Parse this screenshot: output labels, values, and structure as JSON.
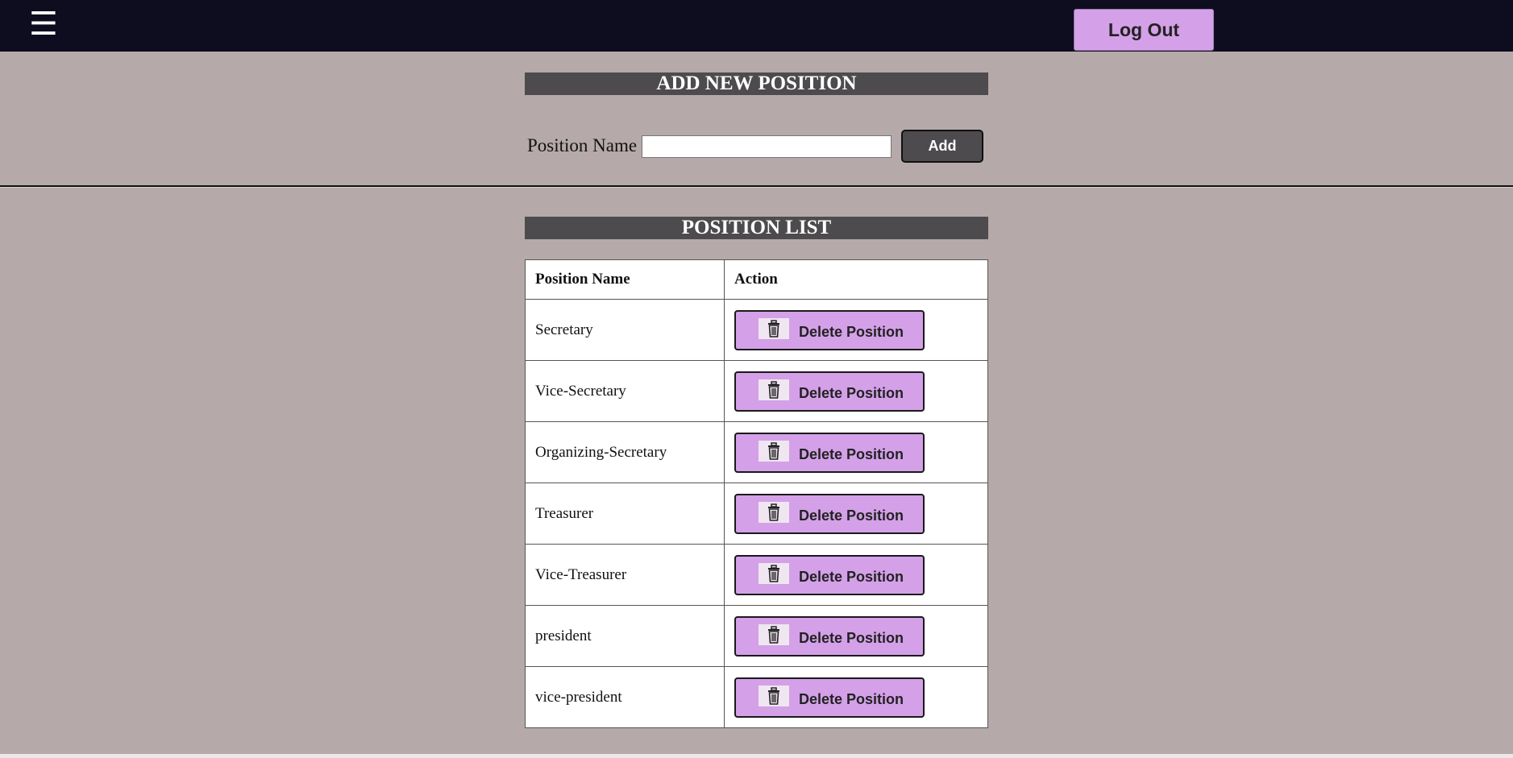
{
  "topbar": {
    "menu_glyph": "☰",
    "logout_label": "Log Out"
  },
  "add_section": {
    "title": "ADD NEW POSITION",
    "label": "Position Name",
    "input_value": "",
    "button_label": "Add"
  },
  "list_section": {
    "title": "POSITION LIST",
    "columns": [
      "Position Name",
      "Action"
    ],
    "delete_label": "Delete Position",
    "rows": [
      {
        "name": "Secretary"
      },
      {
        "name": "Vice-Secretary"
      },
      {
        "name": "Organizing-Secretary"
      },
      {
        "name": "Treasurer"
      },
      {
        "name": "Vice-Treasurer"
      },
      {
        "name": "president"
      },
      {
        "name": "vice-president"
      }
    ]
  },
  "colors": {
    "topbar": "#0d0d1f",
    "page_bg": "#b5a9a9",
    "accent_button": "#d4a0e8",
    "header_bar": "#4d4b4d"
  },
  "icons": {
    "menu": "hamburger-menu-icon",
    "delete": "trash-icon"
  }
}
